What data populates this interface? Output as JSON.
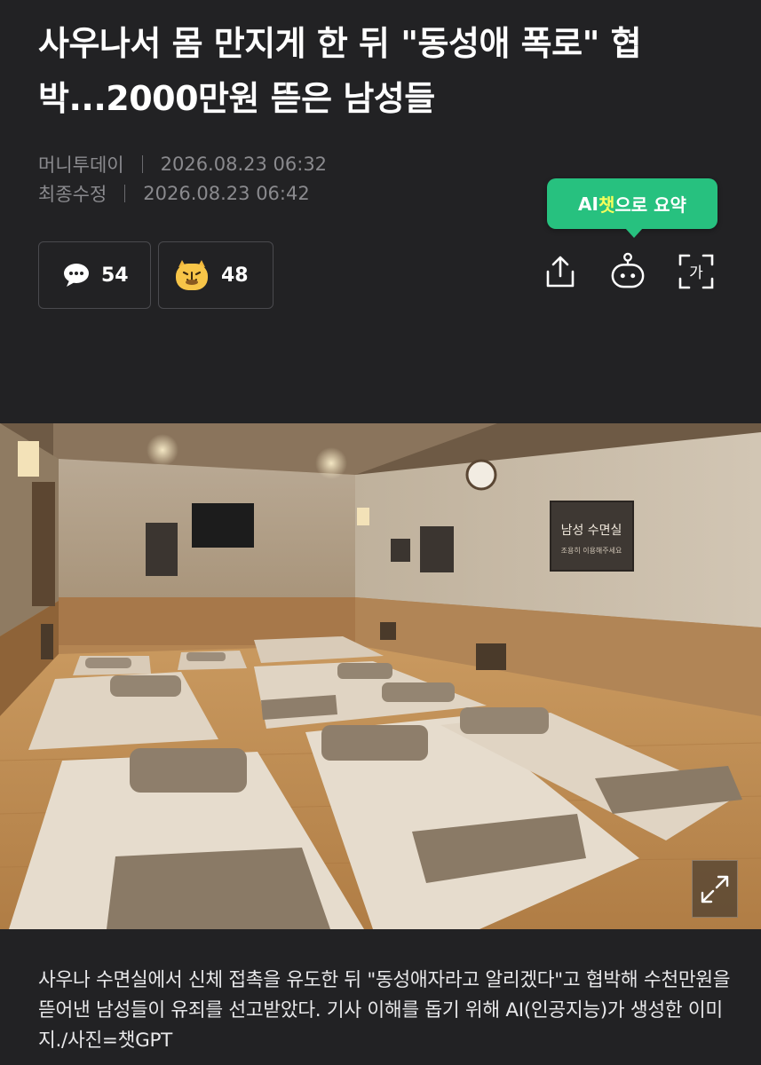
{
  "article": {
    "headline": "사우나서 몸 만지게 한 뒤 \"동성애 폭로\" 협박...2000만원 뜯은 남성들",
    "source": "머니투데이",
    "published": "2026.08.23 06:32",
    "modified_label": "최종수정",
    "modified": "2026.08.23 06:42",
    "caption": "사우나 수면실에서 신체 접촉을 유도한 뒤 \"동성애자라고 알리겠다\"고 협박해 수천만원을 뜯어낸 남성들이 유죄를 선고받았다. 기사 이해를 돕기 위해 AI(인공지능)가 생성한 이미지./사진=챗GPT"
  },
  "stats": {
    "comments": "54",
    "reactions": "48"
  },
  "ai_tip": {
    "prefix": "AI",
    "highlight": "챗",
    "suffix": "으로 요약"
  },
  "actions": {
    "share_icon": "share-icon",
    "ai_bot_icon": "ai-bot-icon",
    "font_size_icon": "font-size-icon",
    "font_size_glyph": "가"
  },
  "photo": {
    "sign_title": "남성 수면실",
    "sign_sub": "조용히 이용해주세요"
  },
  "colors": {
    "background": "#222224",
    "accent_green": "#27c17f",
    "highlight_yellow": "#f6ff5a"
  }
}
